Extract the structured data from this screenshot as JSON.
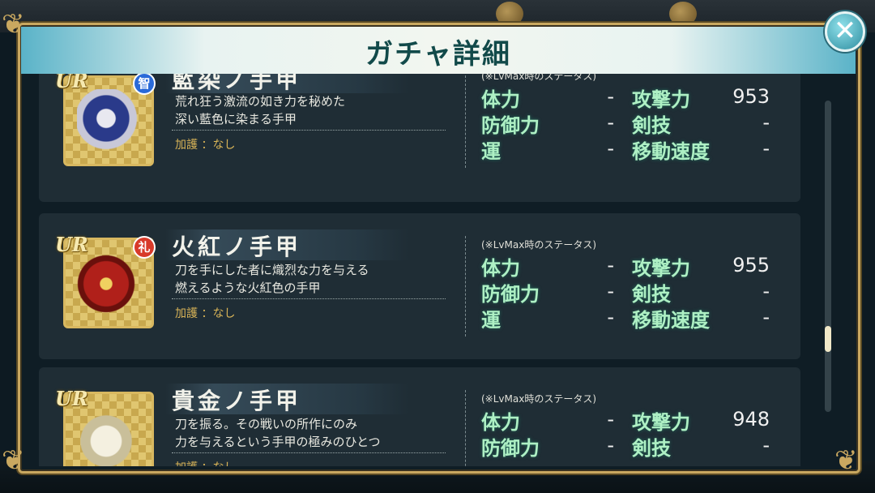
{
  "dialog": {
    "title": "ガチャ詳細"
  },
  "close_glyph": "✕",
  "stat_note": "(※LvMax時のステータス)",
  "stat_labels": {
    "hp": "体力",
    "def": "防御力",
    "luck": "運",
    "atk": "攻撃力",
    "skill": "剣技",
    "speed": "移動速度"
  },
  "blessing_label": "加護 ：なし",
  "items": [
    {
      "rarity": "UR",
      "attribute": "智",
      "attribute_color": "#2a6ad8",
      "name": "藍染ノ手甲",
      "desc1": "荒れ狂う激流の如き力を秘めた",
      "desc2": "深い藍色に染まる手甲",
      "stats": {
        "hp": "-",
        "def": "-",
        "luck": "-",
        "atk": "953",
        "skill": "-",
        "speed": "-"
      }
    },
    {
      "rarity": "UR",
      "attribute": "礼",
      "attribute_color": "#d83a2a",
      "name": "火紅ノ手甲",
      "desc1": "刀を手にした者に熾烈な力を与える",
      "desc2": "燃えるような火紅色の手甲",
      "stats": {
        "hp": "-",
        "def": "-",
        "luck": "-",
        "atk": "955",
        "skill": "-",
        "speed": "-"
      }
    },
    {
      "rarity": "UR",
      "attribute": "",
      "attribute_color": "",
      "name": "貴金ノ手甲",
      "desc1": "刀を振る。その戦いの所作にのみ",
      "desc2": "力を与えるという手甲の極みのひとつ",
      "stats": {
        "hp": "-",
        "def": "-",
        "atk": "948",
        "skill": "-"
      }
    }
  ]
}
